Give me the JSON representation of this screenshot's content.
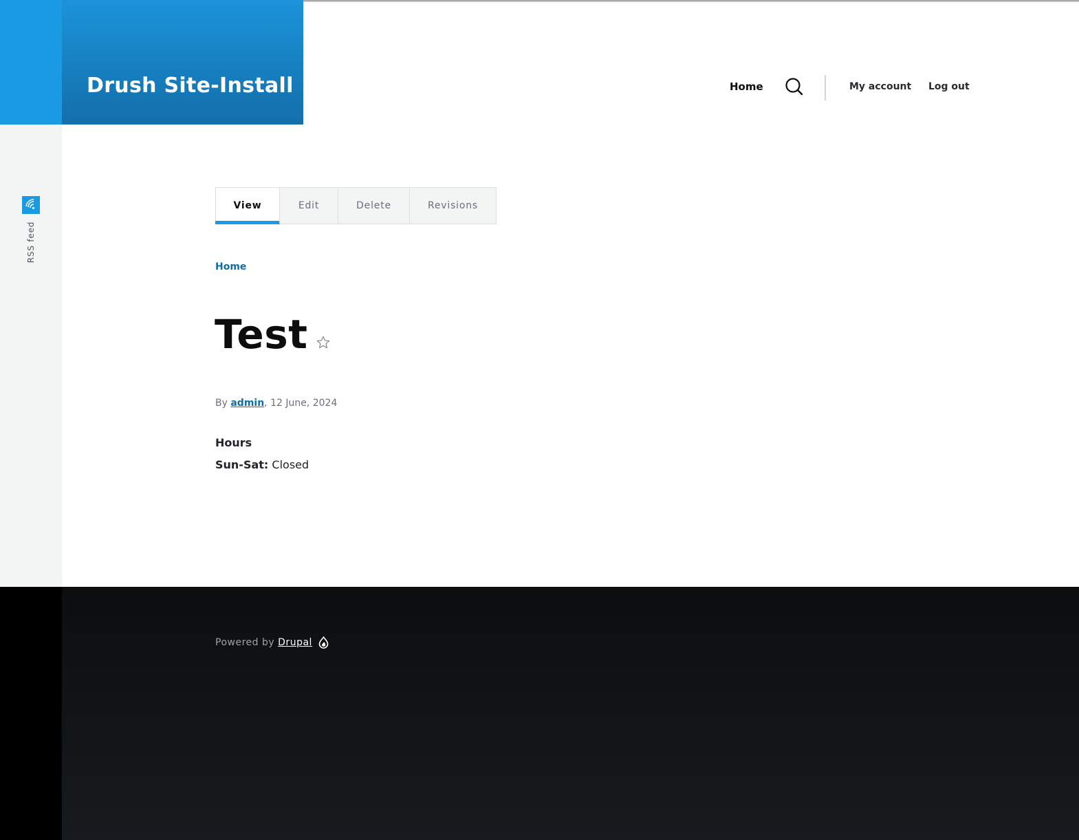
{
  "site": {
    "name": "Drush Site-Install"
  },
  "nav": {
    "home": "Home",
    "account": "My account",
    "logout": "Log out",
    "search_icon": "search-icon"
  },
  "sidebar": {
    "rss_label": "RSS feed",
    "rss_icon": "rss-icon"
  },
  "tabs": [
    {
      "label": "View",
      "active": true
    },
    {
      "label": "Edit",
      "active": false
    },
    {
      "label": "Delete",
      "active": false
    },
    {
      "label": "Revisions",
      "active": false
    }
  ],
  "breadcrumb": [
    "Home"
  ],
  "node": {
    "title": "Test",
    "bookmark_icon": "star-icon",
    "meta_prefix": "By",
    "author": "admin",
    "date": ", 12 June, 2024",
    "field_label": "Hours",
    "hours": [
      {
        "days": "Sun-Sat:",
        "value": "Closed"
      }
    ]
  },
  "footer": {
    "powered_by": "Powered by",
    "drupal_link": "Drupal",
    "drupal_icon": "drupal-icon"
  },
  "colors": {
    "brand_blue": "#1b9ae4",
    "link_blue": "#0d6fa8",
    "footer_bg": "#0c0d0f"
  }
}
